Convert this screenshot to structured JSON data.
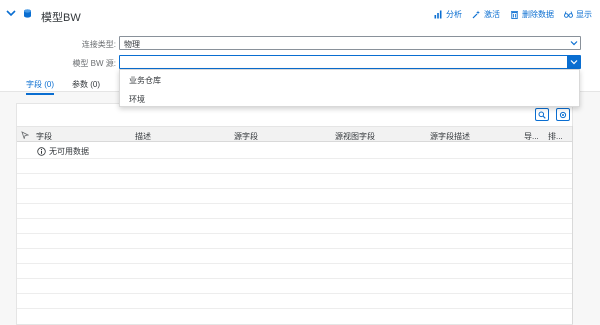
{
  "header": {
    "title": "模型BW",
    "toolbar": [
      {
        "label": "分析",
        "icon": "analyze-icon"
      },
      {
        "label": "激活",
        "icon": "activate-icon"
      },
      {
        "label": "删除数据",
        "icon": "delete-icon"
      },
      {
        "label": "显示",
        "icon": "display-icon"
      }
    ]
  },
  "form": {
    "connection_type_label": "连接类型:",
    "connection_type_value": "物理",
    "bw_source_label": "模型 BW 源:",
    "bw_source_value": ""
  },
  "tabs": [
    {
      "label": "字段 (0)",
      "selected": true
    },
    {
      "label": "参数 (0)",
      "selected": false
    }
  ],
  "table": {
    "columns": [
      "字段",
      "描述",
      "源字段",
      "源视图字段",
      "源字段描述",
      "导...",
      "排..."
    ],
    "empty_text": "无可用数据"
  },
  "dropdown": {
    "options": [
      "业务仓库",
      "环境"
    ]
  },
  "colors": {
    "accent": "#0a6ed1",
    "text": "#32363a",
    "label": "#6a6d70",
    "background": "#f7f7f7"
  }
}
